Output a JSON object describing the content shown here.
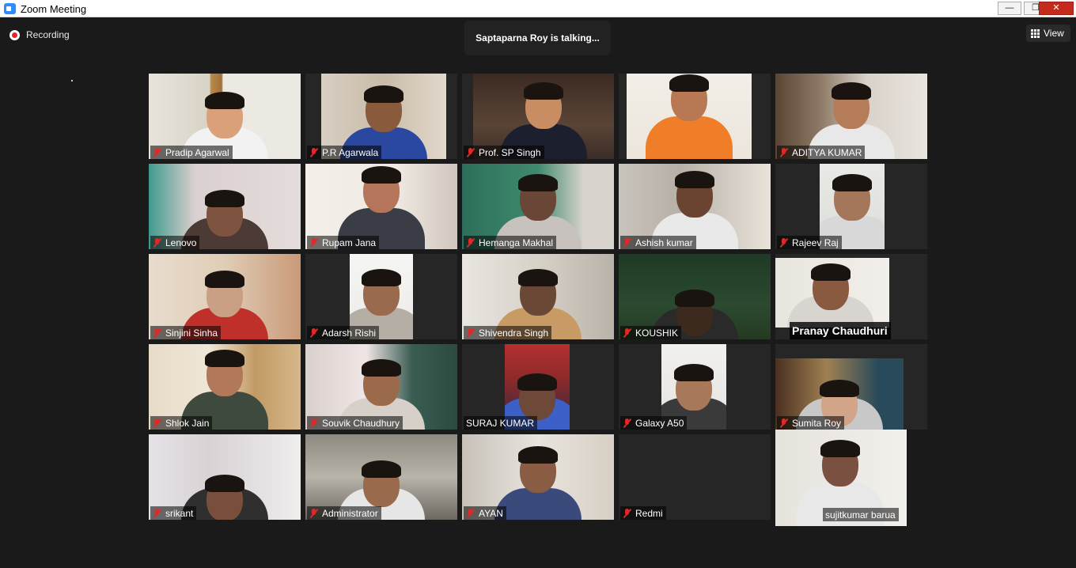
{
  "window": {
    "title": "Zoom Meeting",
    "min": "—",
    "max": "❐",
    "close": "✕"
  },
  "recording": {
    "label": "Recording"
  },
  "talking_banner": "Saptaparna Roy is talking...",
  "view_button": {
    "label": "View",
    "icon": "grid-icon"
  },
  "colors": {
    "accent": "#2d8cff",
    "muted": "#e02828",
    "background": "#1a1a1a"
  },
  "participants": [
    {
      "name": "Pradip Agarwal",
      "muted": true
    },
    {
      "name": "P.R Agarwala",
      "muted": true
    },
    {
      "name": "Prof. SP Singh",
      "muted": true
    },
    {
      "name": "",
      "muted": false
    },
    {
      "name": "ADITYA KUMAR",
      "muted": true
    },
    {
      "name": "Lenovo",
      "muted": true
    },
    {
      "name": "Rupam Jana",
      "muted": true
    },
    {
      "name": "Hemanga Makhal",
      "muted": true
    },
    {
      "name": "Ashish kumar",
      "muted": true
    },
    {
      "name": "Rajeev Raj",
      "muted": true
    },
    {
      "name": "Sinjini Sinha",
      "muted": true
    },
    {
      "name": "Adarsh Rishi",
      "muted": true
    },
    {
      "name": "Shivendra Singh",
      "muted": true
    },
    {
      "name": "KOUSHIK",
      "muted": true
    },
    {
      "name": "Pranay Chaudhuri",
      "muted": false
    },
    {
      "name": "Shlok Jain",
      "muted": true
    },
    {
      "name": "Souvik Chaudhury",
      "muted": true
    },
    {
      "name": "SURAJ KUMAR",
      "muted": false
    },
    {
      "name": "Galaxy A50",
      "muted": true
    },
    {
      "name": "Sumita Roy",
      "muted": true
    },
    {
      "name": "srikant",
      "muted": true
    },
    {
      "name": "Administrator",
      "muted": true
    },
    {
      "name": "AYAN",
      "muted": true
    },
    {
      "name": "Redmi",
      "muted": true
    },
    {
      "name": "sujitkumar barua",
      "muted": false
    }
  ]
}
